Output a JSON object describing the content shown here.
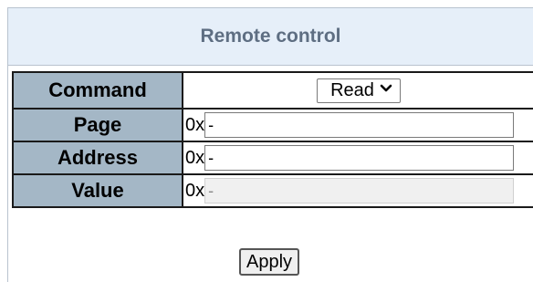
{
  "panel": {
    "title": "Remote control"
  },
  "rows": {
    "command": {
      "label": "Command",
      "selected": "Read",
      "chevron_icon": "chevron-down-icon"
    },
    "page": {
      "label": "Page",
      "prefix": "0x",
      "value": "-"
    },
    "address": {
      "label": "Address",
      "prefix": "0x",
      "value": "-"
    },
    "value": {
      "label": "Value",
      "prefix": "0x",
      "value": "-",
      "disabled": true
    }
  },
  "actions": {
    "apply_label": "Apply"
  },
  "colors": {
    "header_bg": "#e6eff9",
    "header_text": "#5e6e82",
    "label_bg": "#a4b7c6"
  }
}
